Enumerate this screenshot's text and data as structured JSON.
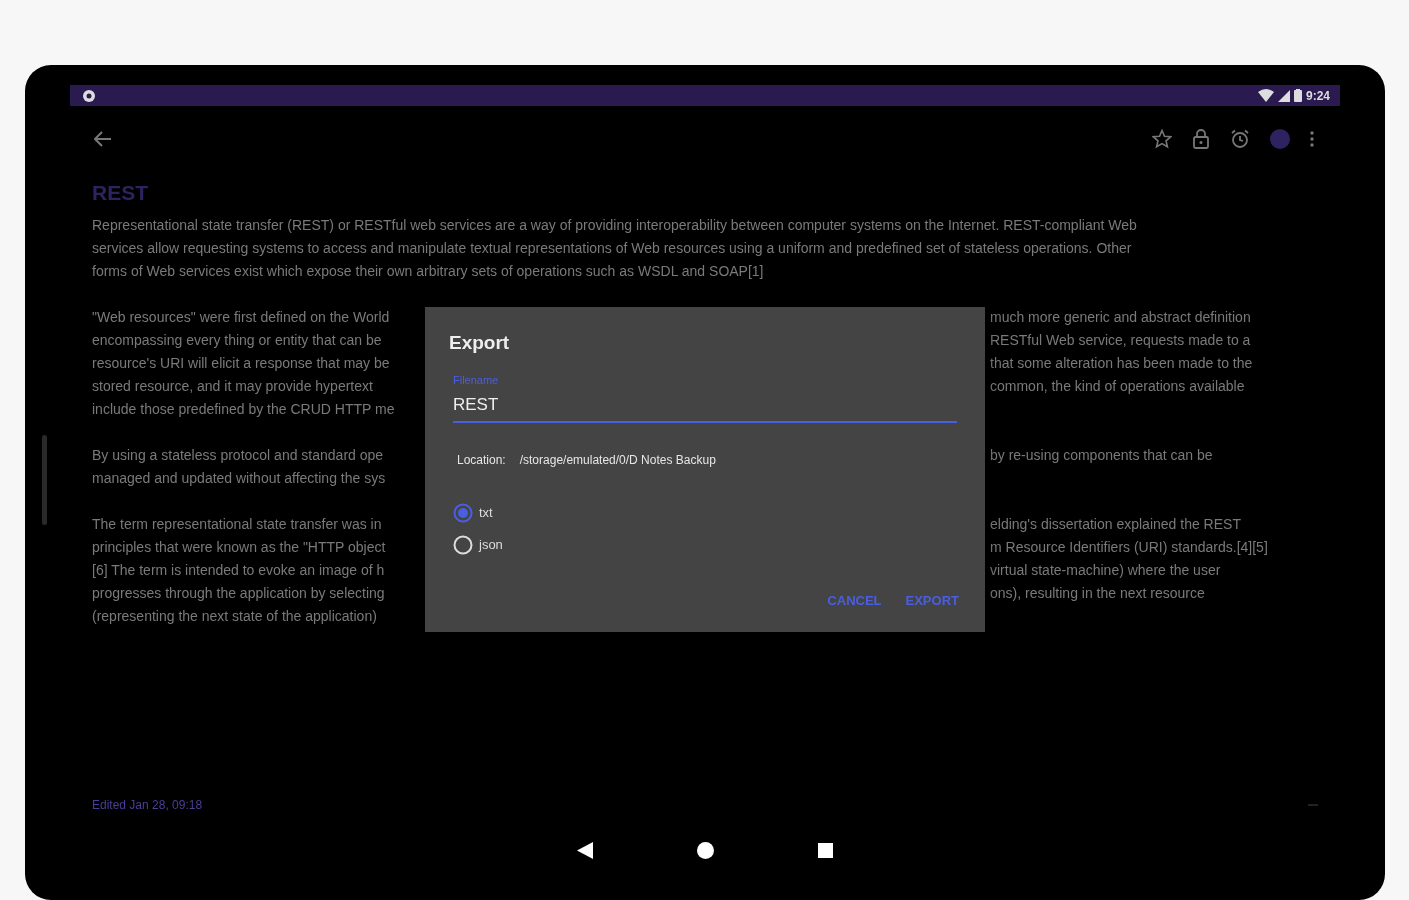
{
  "status_bar": {
    "time": "9:24"
  },
  "note": {
    "title": "REST",
    "paragraphs": [
      {
        "lines": [
          {
            "left": "Representational state transfer (REST) or RESTful web services are a way of providing interoperability between computer systems on the Internet. REST-compliant Web"
          },
          {
            "left": "services allow requesting systems to access and manipulate textual representations of Web resources using a uniform and predefined set of stateless operations. Other"
          },
          {
            "left": "forms of Web services exist which expose their own arbitrary sets of operations such as WSDL and SOAP[1]"
          }
        ]
      },
      {
        "lines": [
          {
            "left": "\"Web resources\" were first defined on the World",
            "right": "much more generic and abstract definition"
          },
          {
            "left": "encompassing every thing or entity that can be",
            "right": "RESTful Web service, requests made to a"
          },
          {
            "left": "resource's URI will elicit a response that may be",
            "right": "that some alteration has been made to the"
          },
          {
            "left": "stored resource, and it may provide hypertext",
            "right": "common, the kind of operations available"
          },
          {
            "left": "include those predefined by the CRUD HTTP me"
          }
        ]
      },
      {
        "lines": [
          {
            "left": "By using a stateless protocol and standard ope",
            "right": "by re-using components that can be"
          },
          {
            "left": "managed and updated without affecting the sys"
          }
        ]
      },
      {
        "lines": [
          {
            "left": "The term representational state transfer was in",
            "right": "elding's dissertation explained the REST"
          },
          {
            "left": "principles that were known as the \"HTTP object",
            "right": "m Resource Identifiers (URI) standards.[4][5]"
          },
          {
            "left": "[6] The term is intended to evoke an image of h",
            "right": "virtual state-machine) where the user"
          },
          {
            "left": "progresses through the application by selecting",
            "right": "ons), resulting in the next resource"
          },
          {
            "left": "(representing the next state of the application)"
          }
        ]
      }
    ],
    "edited": "Edited Jan 28, 09:18"
  },
  "dialog": {
    "title": "Export",
    "filename": {
      "label": "Filename",
      "value": "REST",
      "focused": true
    },
    "location": {
      "label": "Location:",
      "value": "/storage/emulated/0/D Notes Backup"
    },
    "formats": [
      {
        "label": "txt",
        "selected": true
      },
      {
        "label": "json",
        "selected": false
      }
    ],
    "buttons": [
      "CANCEL",
      "EXPORT"
    ]
  }
}
